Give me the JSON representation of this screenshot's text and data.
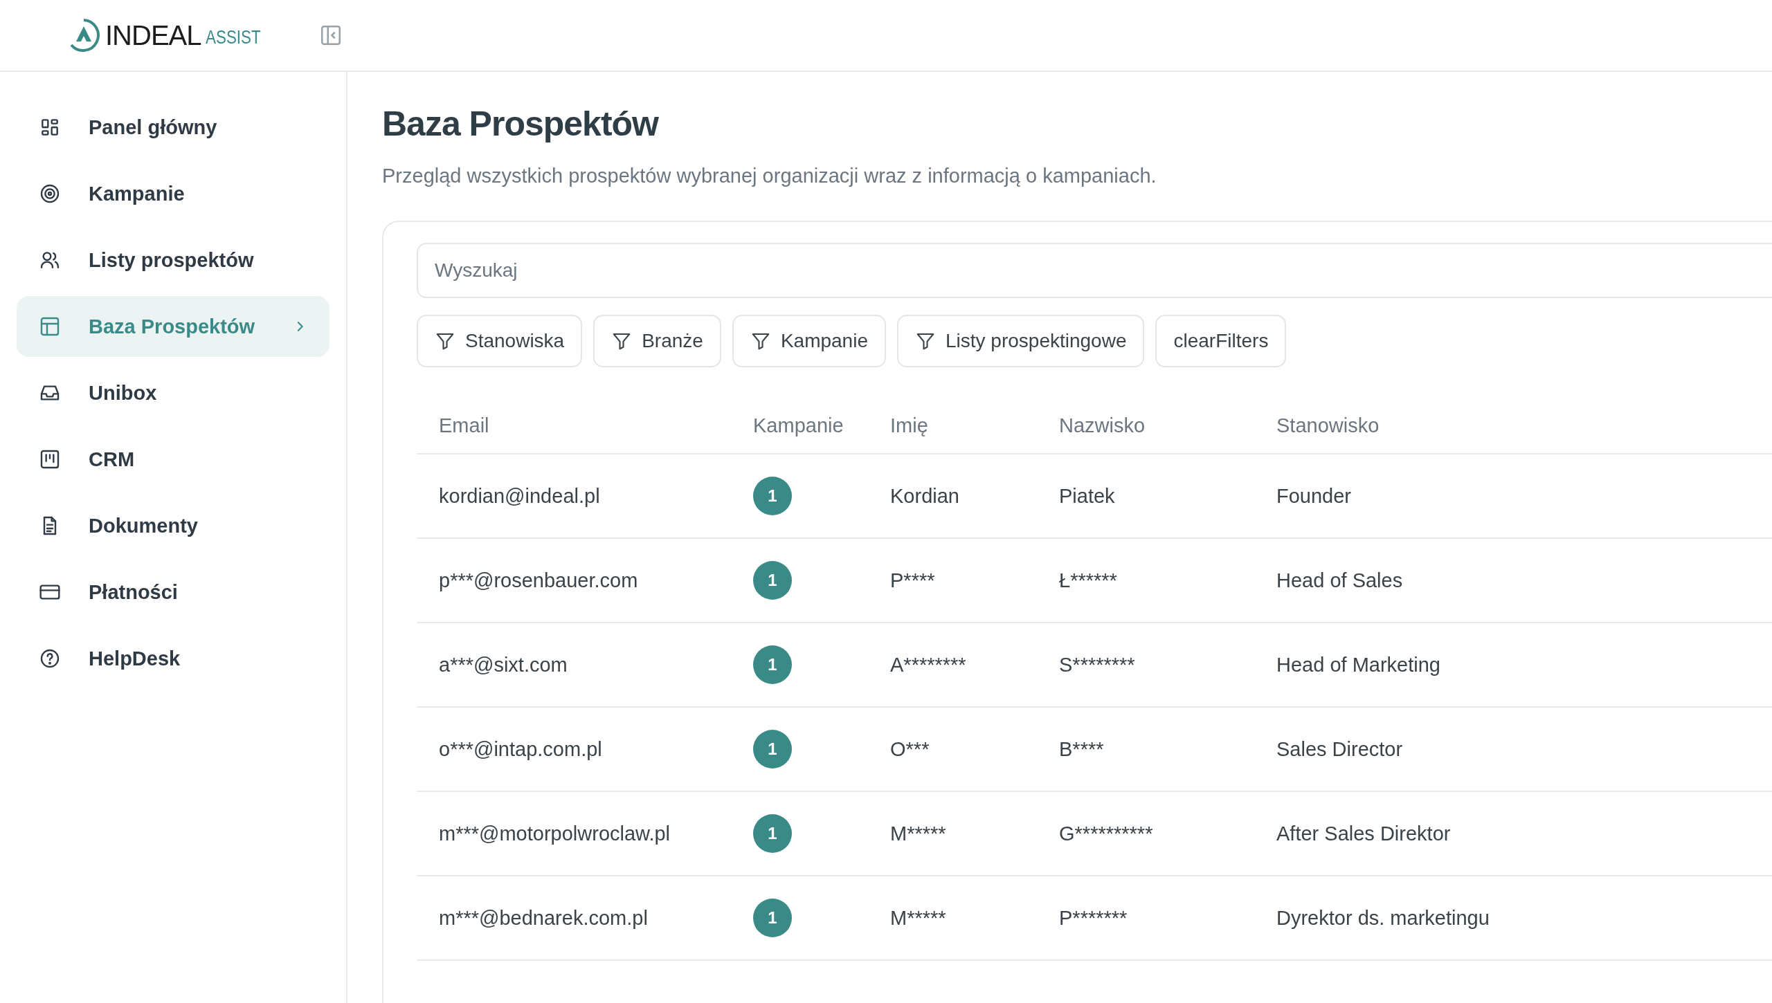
{
  "header": {
    "logo_text": "INDEAL",
    "logo_subtext": "ASSIST"
  },
  "sidebar": {
    "items": [
      {
        "label": "Panel główny",
        "selected": false
      },
      {
        "label": "Kampanie",
        "selected": false
      },
      {
        "label": "Listy prospektów",
        "selected": false
      },
      {
        "label": "Baza Prospektów",
        "selected": true
      },
      {
        "label": "Unibox",
        "selected": false
      },
      {
        "label": "CRM",
        "selected": false
      },
      {
        "label": "Dokumenty",
        "selected": false
      },
      {
        "label": "Płatności",
        "selected": false
      },
      {
        "label": "HelpDesk",
        "selected": false
      }
    ]
  },
  "page": {
    "title": "Baza Prospektów",
    "subtitle": "Przegląd wszystkich prospektów wybranej organizacji wraz z informacją o kampaniach."
  },
  "search": {
    "placeholder": "Wyszukaj"
  },
  "filters": [
    {
      "label": "Stanowiska",
      "kind": "filter"
    },
    {
      "label": "Branże",
      "kind": "filter"
    },
    {
      "label": "Kampanie",
      "kind": "filter"
    },
    {
      "label": "Listy prospektingowe",
      "kind": "filter"
    },
    {
      "label": "clearFilters",
      "kind": "plain"
    }
  ],
  "table": {
    "columns": [
      "Email",
      "Kampanie",
      "Imię",
      "Nazwisko",
      "Stanowisko"
    ],
    "rows": [
      {
        "email": "kordian@indeal.pl",
        "campaigns": "1",
        "first_name": "Kordian",
        "last_name": "Piatek",
        "position": "Founder"
      },
      {
        "email": "p***@rosenbauer.com",
        "campaigns": "1",
        "first_name": "P****",
        "last_name": "Ł******",
        "position": "Head of Sales"
      },
      {
        "email": "a***@sixt.com",
        "campaigns": "1",
        "first_name": "A********",
        "last_name": "S********",
        "position": "Head of Marketing"
      },
      {
        "email": "o***@intap.com.pl",
        "campaigns": "1",
        "first_name": "O***",
        "last_name": "B****",
        "position": "Sales Director"
      },
      {
        "email": "m***@motorpolwroclaw.pl",
        "campaigns": "1",
        "first_name": "M*****",
        "last_name": "G**********",
        "position": "After Sales Direktor"
      },
      {
        "email": "m***@bednarek.com.pl",
        "campaigns": "1",
        "first_name": "M*****",
        "last_name": "P*******",
        "position": "Dyrektor ds. marketingu"
      }
    ]
  }
}
